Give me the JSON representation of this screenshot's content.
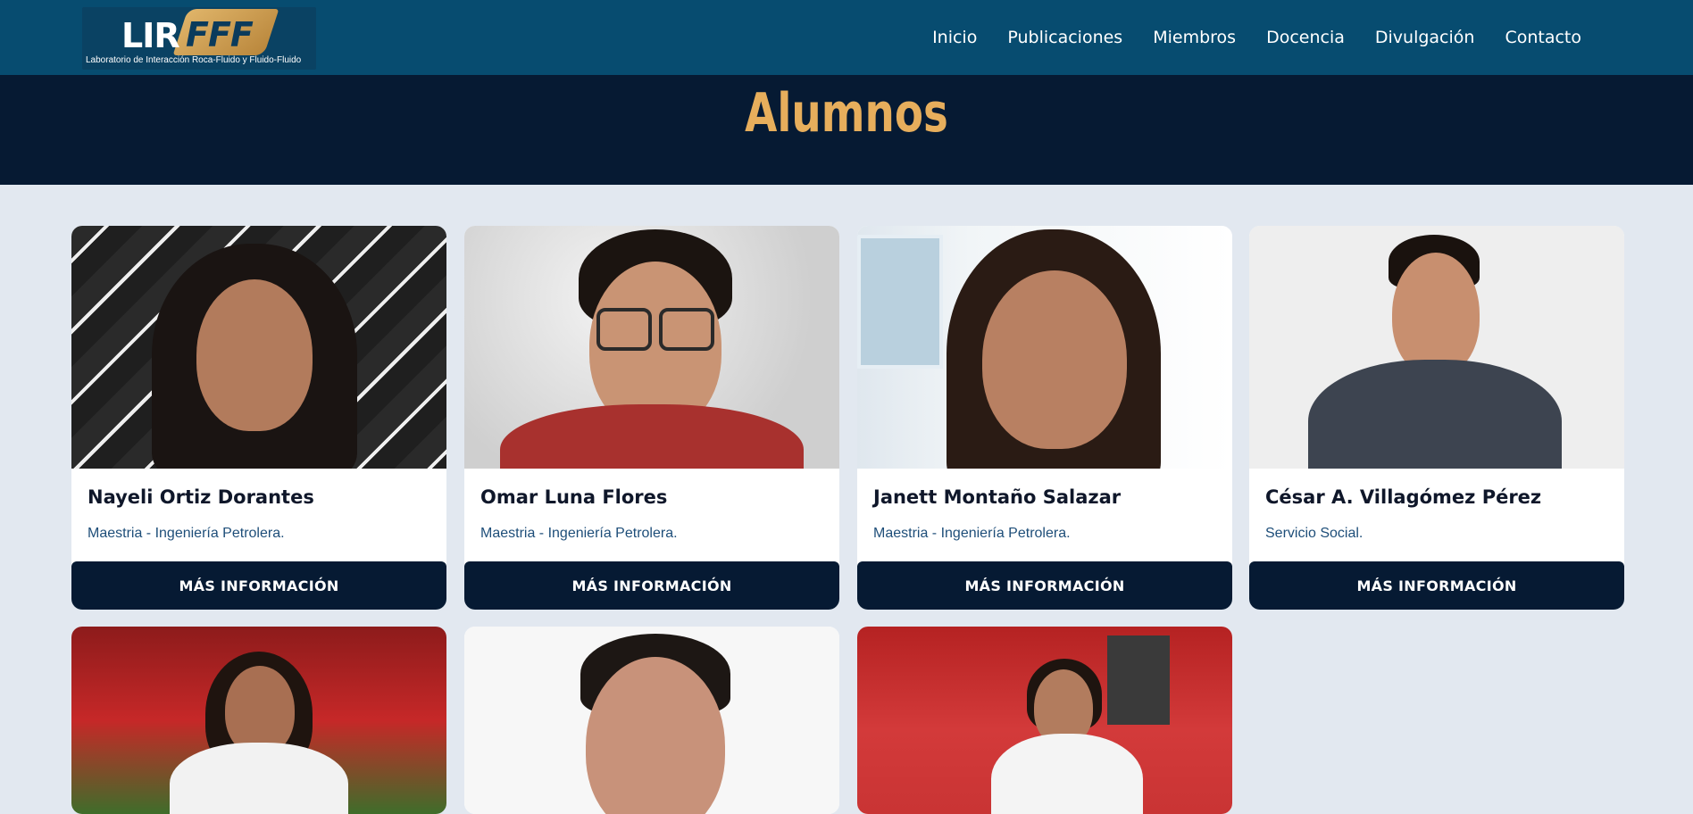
{
  "brand": {
    "logo_main": "LIR",
    "logo_badge": "FFF",
    "logo_subtitle": "Laboratorio de Interacción Roca-Fluido y Fluido-Fluido"
  },
  "nav": {
    "items": [
      "Inicio",
      "Publicaciones",
      "Miembros",
      "Docencia",
      "Divulgación",
      "Contacto"
    ]
  },
  "page": {
    "title": "Alumnos"
  },
  "cards": [
    {
      "name": "Nayeli Ortiz Dorantes",
      "role": "Maestria - Ingeniería Petrolera.",
      "button": "MÁS INFORMACIÓN"
    },
    {
      "name": "Omar Luna Flores",
      "role": "Maestria - Ingeniería Petrolera.",
      "button": "MÁS INFORMACIÓN"
    },
    {
      "name": "Janett Montaño Salazar",
      "role": "Maestria - Ingeniería Petrolera.",
      "button": "MÁS INFORMACIÓN"
    },
    {
      "name": "César A. Villagómez Pérez",
      "role": "Servicio Social.",
      "button": "MÁS INFORMACIÓN"
    }
  ],
  "colors": {
    "header_bg": "#074c70",
    "title_band_bg": "#061a33",
    "title_color": "#e7ae5c",
    "page_bg": "#e2e8f0",
    "button_bg": "#061a33"
  }
}
